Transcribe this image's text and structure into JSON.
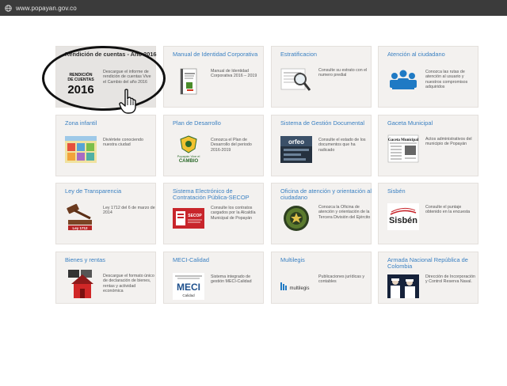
{
  "browser": {
    "url": "www.popayan.gov.co"
  },
  "cards": [
    {
      "title": "Rendición de cuentas - Año 2016",
      "desc": "Descargue el informe de rendición de cuentas Vive el Cambio del año 2016",
      "thumb_text": "RENDICIÓN DE CUENTAS 2016",
      "icon": "rendicion-2016-icon"
    },
    {
      "title": "Manual de Identidad Corporativa",
      "desc": "Manual de Identidad Corporativa 2016 – 2019",
      "thumb_text": "Manual de Identidad Corporativa 2016 - 2019",
      "icon": "manual-book-icon"
    },
    {
      "title": "Estratificacion",
      "desc": "Consulte su estrato con el numero predial",
      "icon": "magnifier-document-icon"
    },
    {
      "title": "Atención al ciudadano",
      "desc": "Conozca las rutas de atención al usuario y nuestros compromisos adquiridos",
      "icon": "people-group-icon"
    },
    {
      "title": "Zona infantil",
      "desc": "Diviértete conociendo nuestra ciudad",
      "icon": "kids-zone-icon"
    },
    {
      "title": "Plan de Desarrollo",
      "desc": "Conozca el Plan de Desarrollo del periodo 2016-2019",
      "thumb_text": "Popayán Vive el CAMBIO",
      "icon": "plan-desarrollo-logo-icon"
    },
    {
      "title": "Sistema de Gestión Documental",
      "desc": "Consulte el estado de los documentos que ha radicado",
      "thumb_text": "orfeo",
      "icon": "orfeo-icon"
    },
    {
      "title": "Gaceta Municipal",
      "desc": "Actos administrativos del municipio de Popayán",
      "thumb_text": "Gaceta Municipal",
      "icon": "newspaper-icon"
    },
    {
      "title": "Ley de Transparencia",
      "desc": "Ley 1712 del 6 de marzo de 2014",
      "thumb_text": "Ley 1712",
      "icon": "gavel-icon"
    },
    {
      "title": "Sistema Electrónico de Contratación Pública-SECOP",
      "desc": "Consulte los contratos cargados por la Alcaldía Municipal de Popayán",
      "thumb_text": "SECOP",
      "icon": "secop-icon"
    },
    {
      "title": "Oficina de atención y orientación al ciudadano",
      "desc": "Conozca la Oficina de atención y orientación de la Tercera División del Ejército",
      "icon": "army-badge-icon"
    },
    {
      "title": "Sisbén",
      "desc": "Consulte el puntaje obtenido en la encuesta",
      "thumb_text": "Sisbén",
      "icon": "sisben-logo-icon"
    },
    {
      "title": "Bienes y rentas",
      "desc": "Descargue el formato único de declaración de bienes, rentas y actividad económica",
      "icon": "house-icon"
    },
    {
      "title": "MECI-Calidad",
      "desc": "Sistema integrado de gestión MECI-Calidad",
      "thumb_text": "MECI",
      "thumb_sub": "Calidad",
      "icon": "meci-logo-icon"
    },
    {
      "title": "Multilegis",
      "desc": "Publicaciones jurídicas y contables",
      "thumb_text": "multilegis",
      "icon": "multilegis-logo-icon"
    },
    {
      "title": "Armada Nacional República de Colombia",
      "desc": "Dirección de Incorporación y Control Reserva Naval.",
      "icon": "navy-photo-icon"
    }
  ],
  "colors": {
    "title_blue": "#3a80c2",
    "card_bg": "#f3f1ef",
    "urlbar_bg": "#3b3b3b"
  }
}
